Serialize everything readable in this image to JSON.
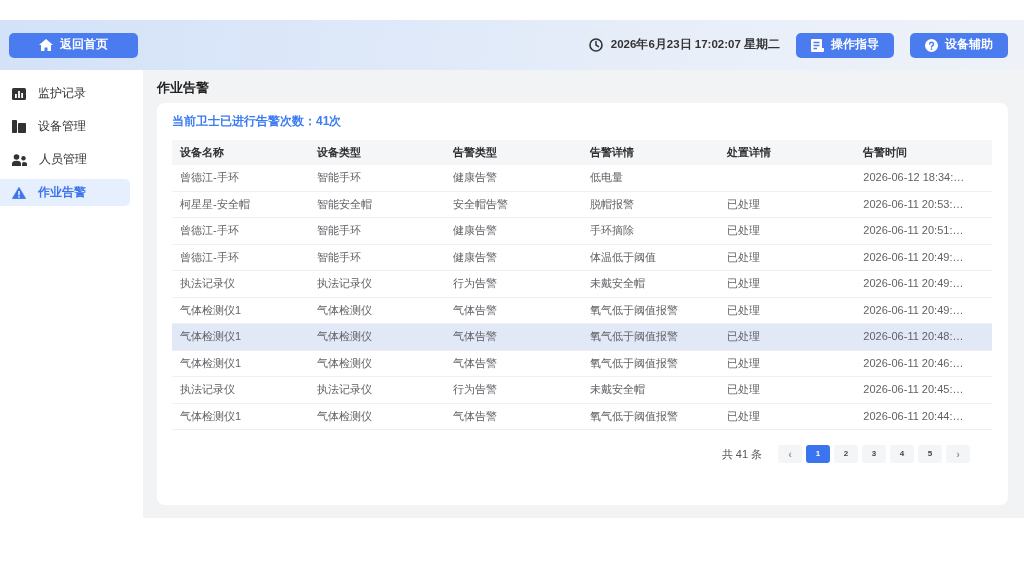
{
  "header": {
    "home_button": "返回首页",
    "datetime": "2026年6月23日 17:02:07 星期二",
    "buttons": [
      "操作指导",
      "设备辅助"
    ]
  },
  "sidebar": {
    "items": [
      {
        "label": "监护记录",
        "selected": false
      },
      {
        "label": "设备管理",
        "selected": false
      },
      {
        "label": "人员管理",
        "selected": false
      },
      {
        "label": "作业告警",
        "selected": true
      }
    ]
  },
  "page_title": "作业告警",
  "alert_summary": "当前卫士已进行告警次数：41次",
  "table": {
    "columns": [
      "设备名称",
      "设备类型",
      "告警类型",
      "告警详情",
      "处置详情",
      "告警时间"
    ],
    "rows": [
      {
        "device_name": "曾德江-手环",
        "device_type": "智能手环",
        "alert_type": "健康告警",
        "alert_detail": "低电量",
        "alert_time": "2026-06-12 18:34:…",
        "highlighted": false
      },
      {
        "device_name": "柯星星-安全帽",
        "device_type": "智能安全帽",
        "alert_type": "安全帽告警",
        "alert_detail": "脱帽报警",
        "handling_detail": "已处理",
        "alert_time": "2026-06-11 20:53:…",
        "highlighted": false
      },
      {
        "device_name": "曾德江-手环",
        "device_type": "智能手环",
        "alert_type": "健康告警",
        "alert_detail": "手环摘除",
        "handling_detail": "已处理",
        "alert_time": "2026-06-11 20:51:…",
        "highlighted": false
      },
      {
        "device_name": "曾德江-手环",
        "device_type": "智能手环",
        "alert_type": "健康告警",
        "alert_detail": "体温低于阈值",
        "handling_detail": "已处理",
        "alert_time": "2026-06-11 20:49:…",
        "highlighted": false
      },
      {
        "device_name": "执法记录仪",
        "device_type": "执法记录仪",
        "alert_type": "行为告警",
        "alert_detail": "未戴安全帽",
        "handling_detail": "已处理",
        "alert_time": "2026-06-11 20:49:…",
        "highlighted": false
      },
      {
        "device_name": "气体检测仪1",
        "device_type": "气体检测仪",
        "alert_type": "气体告警",
        "alert_detail": "氧气低于阈值报警",
        "handling_detail": "已处理",
        "alert_time": "2026-06-11 20:49:…",
        "highlighted": false
      },
      {
        "device_name": "气体检测仪1",
        "device_type": "气体检测仪",
        "alert_type": "气体告警",
        "alert_detail": "氧气低于阈值报警",
        "handling_detail": "已处理",
        "alert_time": "2026-06-11 20:48:…",
        "highlighted": true
      },
      {
        "device_name": "气体检测仪1",
        "device_type": "气体检测仪",
        "alert_type": "气体告警",
        "alert_detail": "氧气低于阈值报警",
        "handling_detail": "已处理",
        "alert_time": "2026-06-11 20:46:…",
        "highlighted": false
      },
      {
        "device_name": "执法记录仪",
        "device_type": "执法记录仪",
        "alert_type": "行为告警",
        "alert_detail": "未戴安全帽",
        "handling_detail": "已处理",
        "alert_time": "2026-06-11 20:45:…",
        "highlighted": false
      },
      {
        "device_name": "气体检测仪1",
        "device_type": "气体检测仪",
        "alert_type": "气体告警",
        "alert_detail": "氧气低于阈值报警",
        "handling_detail": "已处理",
        "alert_time": "2026-06-11 20:44:…",
        "highlighted": false
      }
    ]
  },
  "pagination": {
    "total": "共 41 条",
    "prev": "‹",
    "next": "›",
    "pages": [
      {
        "label": "1",
        "selected": true
      },
      {
        "label": "2",
        "selected": false
      },
      {
        "label": "3",
        "selected": false
      },
      {
        "label": "4",
        "selected": false
      },
      {
        "label": "5",
        "selected": false
      }
    ]
  }
}
